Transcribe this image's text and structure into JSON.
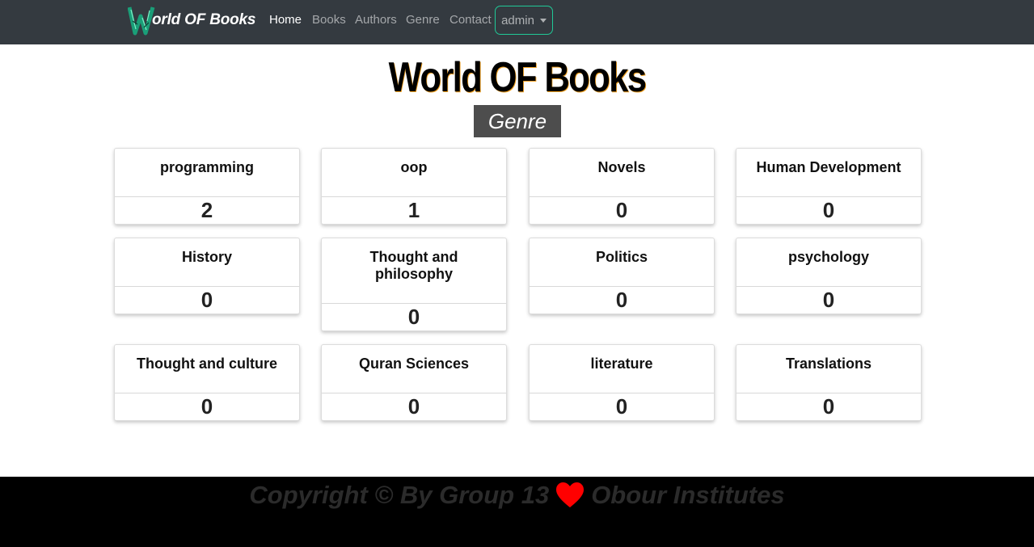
{
  "navbar": {
    "brand": "orld OF Books",
    "brand_logo_letter": "W",
    "links": [
      "Home",
      "Books",
      "Authors",
      "Genre",
      "Contact"
    ],
    "active_link": "Home",
    "user_menu_label": "admin",
    "accent_color": "#20c997",
    "background_color": "#343a40"
  },
  "header": {
    "title": "World OF Books",
    "section_label": "Genre"
  },
  "genres": [
    {
      "name": "programming",
      "count": "2"
    },
    {
      "name": "oop",
      "count": "1"
    },
    {
      "name": "Novels",
      "count": "0"
    },
    {
      "name": "Human Development",
      "count": "0"
    },
    {
      "name": "History",
      "count": "0"
    },
    {
      "name": "Thought and philosophy",
      "count": "0"
    },
    {
      "name": "Politics",
      "count": "0"
    },
    {
      "name": "psychology",
      "count": "0"
    },
    {
      "name": "Thought and culture",
      "count": "0"
    },
    {
      "name": "Quran Sciences",
      "count": "0"
    },
    {
      "name": "literature",
      "count": "0"
    },
    {
      "name": "Translations",
      "count": "0"
    }
  ],
  "footer": {
    "text_before": "Copyright © By Group 13",
    "icon": "heart-icon",
    "text_after": "Obour Institutes",
    "heart_color": "#ff0000"
  }
}
